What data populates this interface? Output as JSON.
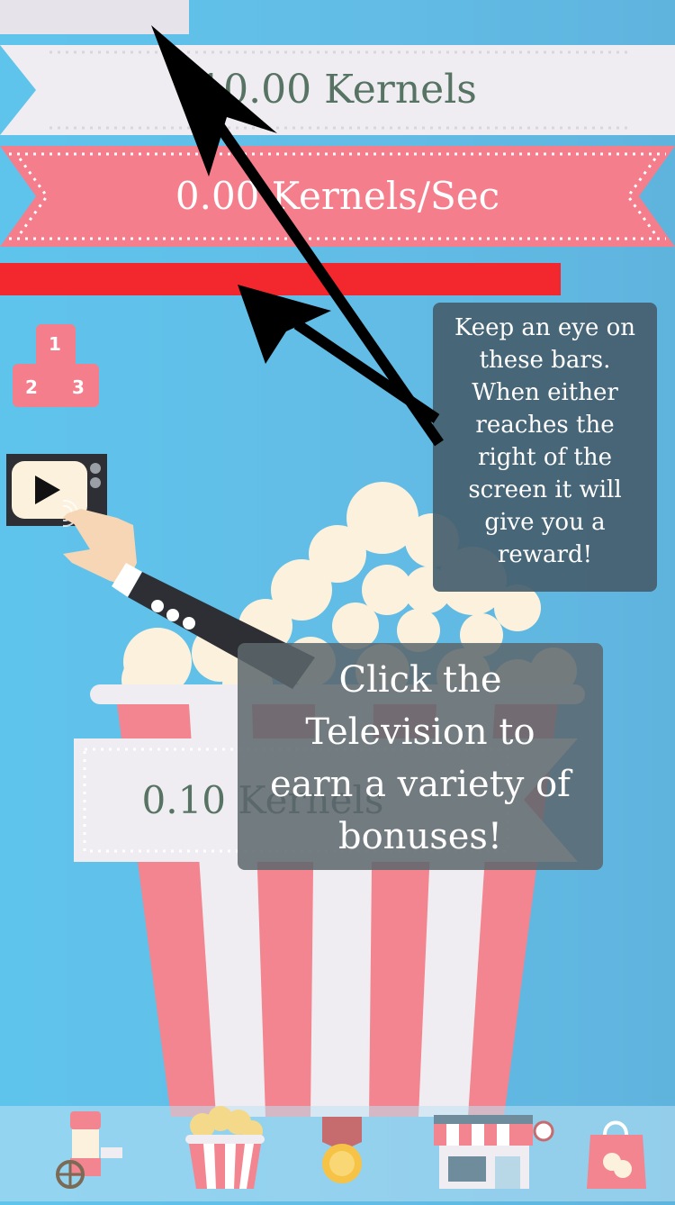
{
  "progress": {
    "kernel_bar_fraction": 0.28,
    "reward_bar_fraction": 0.83,
    "kernel_bar_color": "#e7e3ea",
    "reward_bar_color": "#f3272e"
  },
  "stats": {
    "total_kernels": "10.00 Kernels",
    "kernels_per_sec": "0.00 Kernels/Sec",
    "kernels_per_tap": "0.10 Kernels"
  },
  "leaderboard": {
    "first": "1",
    "second": "2",
    "third": "3"
  },
  "tooltips": {
    "bars": "Keep an eye on\nthese bars.\nWhen either\nreaches the\nright of the\nscreen it will\ngive you a\nreward!",
    "tv": "Click the\nTelevision to\nearn a variety of\nbonuses!"
  },
  "colors": {
    "background": "#60bde6",
    "ribbon_white": "#efedf1",
    "ribbon_pink": "#f47e8c",
    "bucket_red": "#f2858f",
    "tooltip_bg": "#455e6e",
    "kernel_text": "#577363"
  },
  "icons": {
    "leaderboard": "podium-icon",
    "tv": "television-icon",
    "hand": "pointing-hand-icon",
    "nav": [
      "popcorn-cart-icon",
      "popcorn-bucket-icon",
      "medal-icon",
      "shop-icon",
      "shopping-bag-icon"
    ]
  }
}
